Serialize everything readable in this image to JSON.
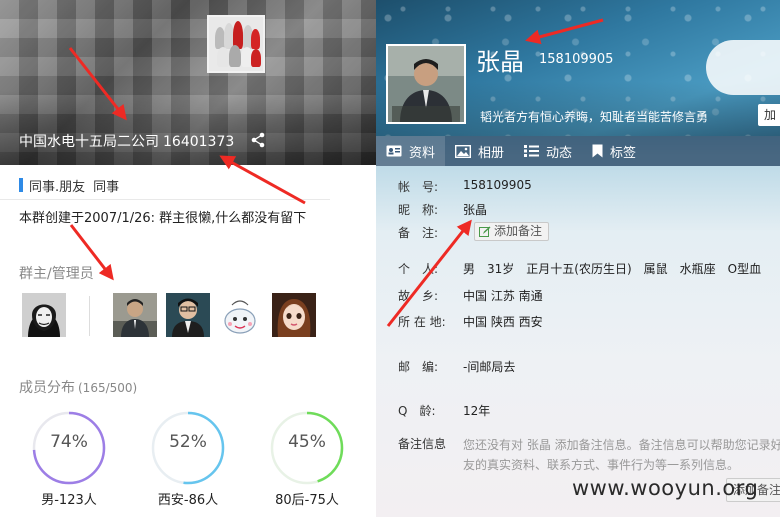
{
  "group": {
    "name": "中国水电十五局二公司",
    "number": "16401373",
    "tags": [
      "同事.朋友",
      "同事"
    ],
    "description": "本群创建于2007/1/26:  群主很懒,什么都没有留下"
  },
  "admins": {
    "title": "群主/管理员",
    "avatar_count_shown": "5"
  },
  "members": {
    "title": "成员分布",
    "count": "(165/500)",
    "stats": [
      {
        "percent": 74,
        "percent_label": "74%",
        "caption": "男-123人",
        "color": "#9d7ee6"
      },
      {
        "percent": 52,
        "percent_label": "52%",
        "caption": "西安-86人",
        "color": "#66c5ee"
      },
      {
        "percent": 45,
        "percent_label": "45%",
        "caption": "80后-75人",
        "color": "#6fdc5a"
      }
    ]
  },
  "profile": {
    "nickname": "张晶",
    "uin": "158109905",
    "signature": "韬光者方有恒心养晦，知耻者当能苦修言勇",
    "add_label": "加",
    "tabs": [
      {
        "label": "资料",
        "icon": "id-card-icon",
        "active": true
      },
      {
        "label": "相册",
        "icon": "photo-icon",
        "active": false
      },
      {
        "label": "动态",
        "icon": "list-icon",
        "active": false
      },
      {
        "label": "标签",
        "icon": "bookmark-icon",
        "active": false
      }
    ],
    "info": {
      "account_label": "帐　号:",
      "account_value": "158109905",
      "nick_label": "昵　称:",
      "nick_value": "张晶",
      "remark_label": "备　注:",
      "remark_button": "添加备注",
      "personal_label": "个　人:",
      "personal_value": "男　31岁　正月十五(农历生日)　属鼠　水瓶座　O型血",
      "hometown_label": "故　乡:",
      "hometown_value": "中国 江苏 南通",
      "location_label": "所 在 地:",
      "location_value": "中国 陕西 西安",
      "postcode_label": "邮　编:",
      "postcode_value": "-间邮局去",
      "qage_label": "Q　龄:",
      "qage_value": "12年",
      "remark_info_label": "备注信息",
      "remark_info_desc": "您还没有对 张晶 添加备注信息。备注信息可以帮助您记录好友的真实资料、联系方式、事件行为等一系列信息。",
      "bottom_button": "添加备注"
    }
  },
  "watermark": "www.wooyun.org",
  "colors": {
    "arrow": "#ee2a24",
    "tag_bar": "#2e8ae6",
    "tabbar": "#284664"
  }
}
